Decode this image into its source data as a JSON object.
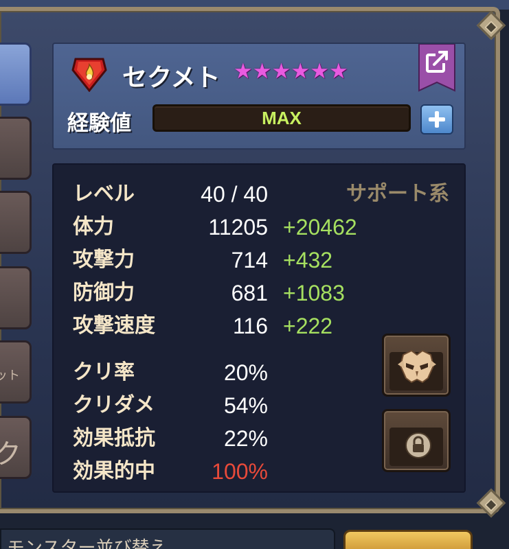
{
  "monster": {
    "name": "セクメト",
    "stars": [
      "★",
      "★",
      "★",
      "★",
      "★",
      "★"
    ],
    "element_icon": "fire-element-icon"
  },
  "header": {
    "exp_label": "経験値",
    "exp_value": "MAX",
    "share_icon": "share-icon",
    "add_icon": "plus-icon"
  },
  "side_tabs": {
    "tab_text_4": "ット",
    "tab_text_5": "ク"
  },
  "stats": {
    "type": "サポート系",
    "level": {
      "label": "レベル",
      "value": "40 / 40"
    },
    "hp": {
      "label": "体力",
      "value": "11205",
      "bonus": "+20462"
    },
    "atk": {
      "label": "攻撃力",
      "value": "714",
      "bonus": "+432"
    },
    "def": {
      "label": "防御力",
      "value": "681",
      "bonus": "+1083"
    },
    "spd": {
      "label": "攻撃速度",
      "value": "116",
      "bonus": "+222"
    },
    "crit_rate": {
      "label": "クリ率",
      "value": "20%"
    },
    "crit_dmg": {
      "label": "クリダメ",
      "value": "54%"
    },
    "resist": {
      "label": "効果抵抗",
      "value": "22%"
    },
    "accuracy": {
      "label": "効果的中",
      "value": "100%"
    }
  },
  "colors": {
    "bonus_green": "#a6e060",
    "accuracy_red": "#e84a3a",
    "star_pink": "#e85be0"
  },
  "bottom": {
    "text": "モンスター並び替え"
  }
}
